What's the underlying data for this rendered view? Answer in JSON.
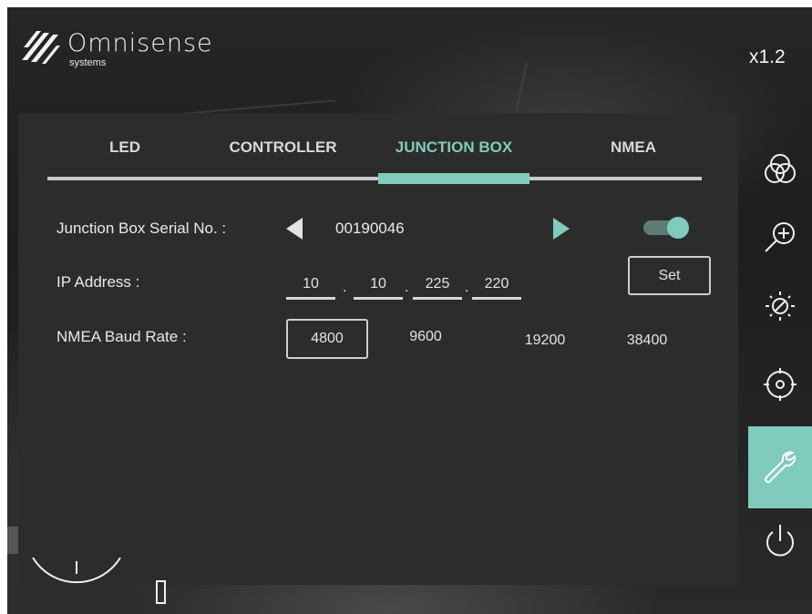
{
  "brand": {
    "name": "Omnisense",
    "subtitle": "systems"
  },
  "zoom_label": "x1.2",
  "tabs": [
    {
      "label": "LED",
      "active": false
    },
    {
      "label": "CONTROLLER",
      "active": false
    },
    {
      "label": "JUNCTION BOX",
      "active": true
    },
    {
      "label": "NMEA",
      "active": false
    }
  ],
  "serial": {
    "label": "Junction Box Serial No. :",
    "value": "00190046",
    "enabled": true
  },
  "ip": {
    "label": "IP Address :",
    "octets": [
      "10",
      "10",
      "225",
      "220"
    ],
    "separator": ".",
    "set_label": "Set"
  },
  "baud": {
    "label": "NMEA Baud Rate :",
    "options": [
      "4800",
      "9600",
      "19200",
      "38400"
    ],
    "selected": "4800"
  },
  "sidebar": [
    {
      "icon": "color-channels-icon",
      "active": false
    },
    {
      "icon": "zoom-in-icon",
      "active": false
    },
    {
      "icon": "brightness-contrast-icon",
      "active": false
    },
    {
      "icon": "crosshair-target-icon",
      "active": false
    },
    {
      "icon": "wrench-settings-icon",
      "active": true
    },
    {
      "icon": "power-icon",
      "active": false
    }
  ],
  "colors": {
    "accent": "#7fcbbd",
    "panel": "#2c2c2c",
    "text": "#eaeaea"
  }
}
